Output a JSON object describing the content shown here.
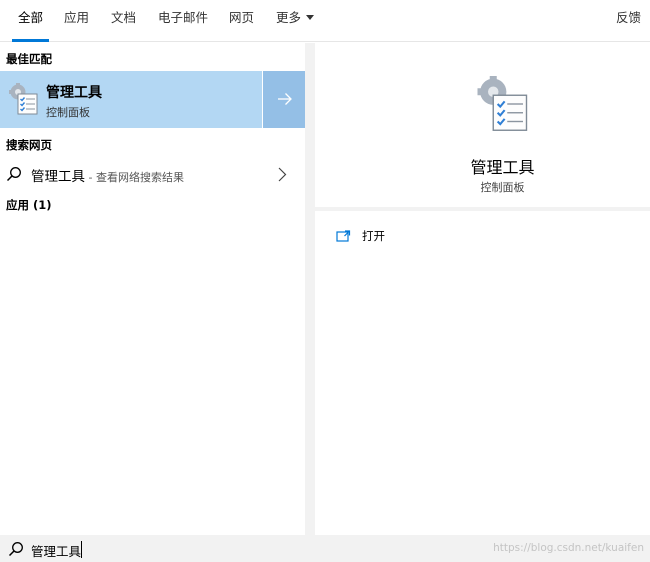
{
  "tabs": [
    {
      "label": "全部",
      "active": true
    },
    {
      "label": "应用"
    },
    {
      "label": "文档"
    },
    {
      "label": "电子邮件"
    },
    {
      "label": "网页"
    },
    {
      "label": "更多"
    }
  ],
  "feedback_label": "反馈",
  "best_match": {
    "section_title": "最佳匹配",
    "name": "管理工具",
    "subtitle": "控制面板",
    "icon": "admin-tools-icon"
  },
  "web_search": {
    "section_title": "搜索网页",
    "query": "管理工具",
    "hint": " - 查看网络搜索结果"
  },
  "apps_section_title": "应用 (1)",
  "preview": {
    "title": "管理工具",
    "subtitle": "控制面板",
    "open_label": "打开"
  },
  "search_box": {
    "value": "管理工具",
    "watermark": "https://blog.csdn.net/kuaifen"
  },
  "colors": {
    "accent": "#0078d7",
    "selected_bg": "#b3d7f3",
    "arrow_bg": "#94bfe6",
    "pane_gap": "#f2f2f2"
  }
}
